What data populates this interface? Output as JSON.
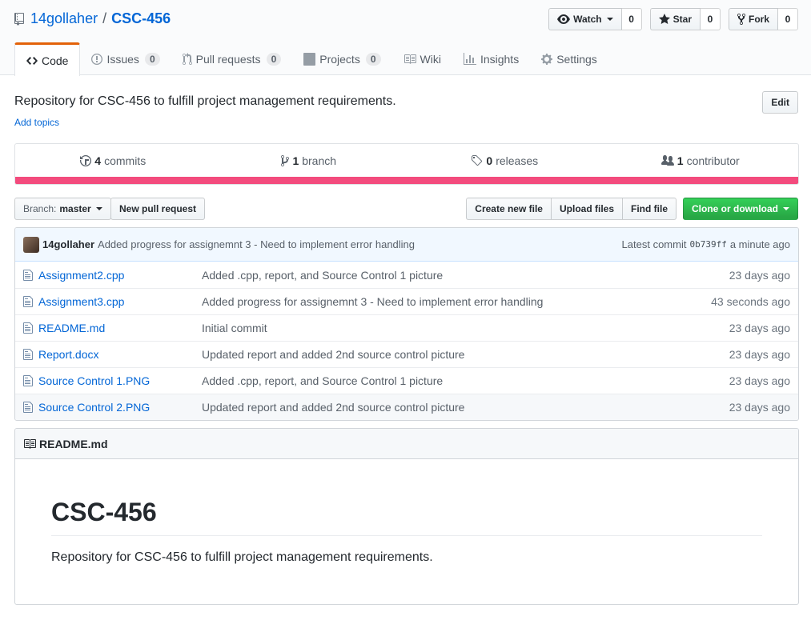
{
  "repo": {
    "owner": "14gollaher",
    "separator": "/",
    "name": "CSC-456"
  },
  "actions": {
    "watch": {
      "label": "Watch",
      "count": "0"
    },
    "star": {
      "label": "Star",
      "count": "0"
    },
    "fork": {
      "label": "Fork",
      "count": "0"
    }
  },
  "tabs": [
    {
      "label": "Code",
      "icon": "code-icon"
    },
    {
      "label": "Issues",
      "count": "0",
      "icon": "issue-icon"
    },
    {
      "label": "Pull requests",
      "count": "0",
      "icon": "pull-request-icon"
    },
    {
      "label": "Projects",
      "count": "0",
      "icon": "project-icon"
    },
    {
      "label": "Wiki",
      "icon": "book-icon"
    },
    {
      "label": "Insights",
      "icon": "graph-icon"
    },
    {
      "label": "Settings",
      "icon": "gear-icon"
    }
  ],
  "description": "Repository for CSC-456 to fulfill project management requirements.",
  "add_topics": "Add topics",
  "edit_label": "Edit",
  "summary": [
    {
      "count": "4",
      "label": "commits",
      "icon": "history-icon"
    },
    {
      "count": "1",
      "label": "branch",
      "icon": "branch-icon"
    },
    {
      "count": "0",
      "label": "releases",
      "icon": "tag-icon"
    },
    {
      "count": "1",
      "label": "contributor",
      "icon": "people-icon"
    }
  ],
  "language_color": "#f34b7d",
  "branch": {
    "prefix": "Branch:",
    "name": "master"
  },
  "new_pull_request": "New pull request",
  "file_actions": {
    "create": "Create new file",
    "upload": "Upload files",
    "find": "Find file",
    "clone": "Clone or download"
  },
  "latest_commit": {
    "author": "14gollaher",
    "message": "Added progress for assignemnt 3 - Need to implement error handling",
    "prefix": "Latest commit",
    "sha": "0b739ff",
    "age": "a minute ago"
  },
  "files": [
    {
      "name": "Assignment2.cpp",
      "message": "Added .cpp, report, and Source Control 1 picture",
      "age": "23 days ago"
    },
    {
      "name": "Assignment3.cpp",
      "message": "Added progress for assignemnt 3 - Need to implement error handling",
      "age": "43 seconds ago"
    },
    {
      "name": "README.md",
      "message": "Initial commit",
      "age": "23 days ago"
    },
    {
      "name": "Report.docx",
      "message": "Updated report and added 2nd source control picture",
      "age": "23 days ago"
    },
    {
      "name": "Source Control 1.PNG",
      "message": "Added .cpp, report, and Source Control 1 picture",
      "age": "23 days ago"
    },
    {
      "name": "Source Control 2.PNG",
      "message": "Updated report and added 2nd source control picture",
      "age": "23 days ago"
    }
  ],
  "readme": {
    "filename": "README.md",
    "heading": "CSC-456",
    "text": "Repository for CSC-456 to fulfill project management requirements."
  }
}
